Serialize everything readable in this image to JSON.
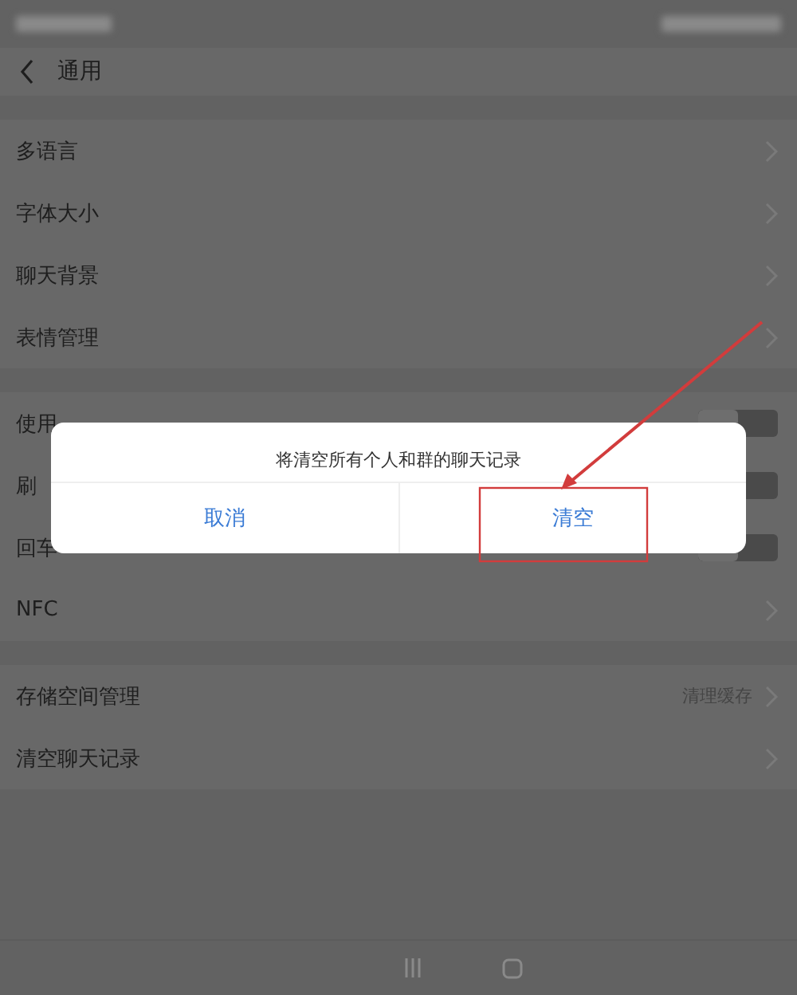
{
  "header": {
    "title": "通用"
  },
  "sections": [
    {
      "items": [
        {
          "label": "多语言",
          "kind": "arrow"
        },
        {
          "label": "字体大小",
          "kind": "arrow"
        },
        {
          "label": "聊天背景",
          "kind": "arrow"
        },
        {
          "label": "表情管理",
          "kind": "arrow"
        }
      ]
    },
    {
      "items": [
        {
          "label": "使用",
          "kind": "toggle",
          "on": false
        },
        {
          "label": "刷",
          "kind": "toggle",
          "on": false
        },
        {
          "label": "回车",
          "kind": "toggle",
          "on": false
        },
        {
          "label": "NFC",
          "kind": "arrow"
        }
      ]
    },
    {
      "items": [
        {
          "label": "存储空间管理",
          "kind": "arrow",
          "value": "清理缓存"
        },
        {
          "label": "清空聊天记录",
          "kind": "arrow"
        }
      ]
    }
  ],
  "dialog": {
    "message": "将清空所有个人和群的聊天记录",
    "buttons": [
      {
        "label": "取消"
      },
      {
        "label": "清空"
      }
    ]
  }
}
